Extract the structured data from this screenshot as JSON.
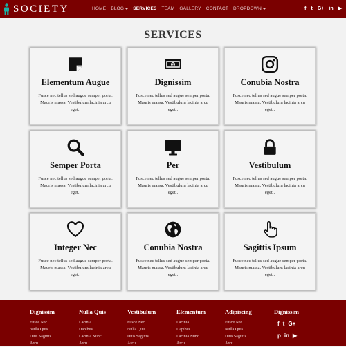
{
  "brand": {
    "name": "SOCIETY"
  },
  "nav": {
    "items": [
      {
        "label": "HOME"
      },
      {
        "label": "BLOG"
      },
      {
        "label": "SERVICES"
      },
      {
        "label": "TEAM"
      },
      {
        "label": "GALLERY"
      },
      {
        "label": "CONTACT"
      },
      {
        "label": "DROPDOWN"
      }
    ]
  },
  "social_top": [
    "f",
    "t",
    "G+",
    "in",
    "▶"
  ],
  "page": {
    "title": "SERVICES"
  },
  "services": [
    {
      "title": "Elementum Augue",
      "icon": "sticky-note-icon",
      "text": "Fusce nec tellus sed augue semper porta. Mauris massa. Vestibulum lacinia arcu eget.."
    },
    {
      "title": "Dignissim",
      "icon": "money-bill-icon",
      "text": "Fusce nec tellus sed augue semper porta. Mauris massa. Vestibulum lacinia arcu eget.."
    },
    {
      "title": "Conubia Nostra",
      "icon": "instagram-icon",
      "text": "Fusce nec tellus sed augue semper porta. Mauris massa. Vestibulum lacinia arcu eget.."
    },
    {
      "title": "Semper Porta",
      "icon": "search-icon",
      "text": "Fusce nec tellus sed augue semper porta. Mauris massa. Vestibulum lacinia arcu eget.."
    },
    {
      "title": "Per",
      "icon": "desktop-icon",
      "text": "Fusce nec tellus sed augue semper porta. Mauris massa. Vestibulum lacinia arcu eget.."
    },
    {
      "title": "Vestibulum",
      "icon": "lock-icon",
      "text": "Fusce nec tellus sed augue semper porta. Mauris massa. Vestibulum lacinia arcu eget.."
    },
    {
      "title": "Integer Nec",
      "icon": "heart-icon",
      "text": "Fusce nec tellus sed augue semper porta. Mauris massa. Vestibulum lacinia arcu eget.."
    },
    {
      "title": "Conubia Nostra",
      "icon": "globe-icon",
      "text": "Fusce nec tellus sed augue semper porta. Mauris massa. Vestibulum lacinia arcu eget.."
    },
    {
      "title": "Sagittis Ipsum",
      "icon": "hand-pointer-icon",
      "text": "Fusce nec tellus sed augue semper porta. Mauris massa. Vestibulum lacinia arcu eget.."
    }
  ],
  "footer": {
    "columns": [
      {
        "heading": "Dignissim",
        "links": [
          "Fusce Nec",
          "Nulla Quis",
          "Duis Sagittis",
          "Arcu"
        ]
      },
      {
        "heading": "Nulla Quis",
        "links": [
          "Lacinia",
          "Dapibus",
          "Lacinia Nunc",
          "Arcu"
        ]
      },
      {
        "heading": "Vestibulum",
        "links": [
          "Fusce Nec",
          "Nulla Quis",
          "Duis Sagittis",
          "Arcu"
        ]
      },
      {
        "heading": "Elementum",
        "links": [
          "Lacinia",
          "Dapibus",
          "Lacinia Nunc",
          "Arcu"
        ]
      },
      {
        "heading": "Adipiscing",
        "links": [
          "Fusce Nec",
          "Nulla Quis",
          "Duis Sagittis",
          "Arcu"
        ]
      }
    ],
    "social_heading": "Dignissim",
    "social": [
      "f",
      "t",
      "G+",
      "p",
      "in",
      "▶"
    ]
  },
  "colors": {
    "primary": "#7a0000",
    "background": "#f2f2f2",
    "brand_icon": "#19b3a6"
  }
}
